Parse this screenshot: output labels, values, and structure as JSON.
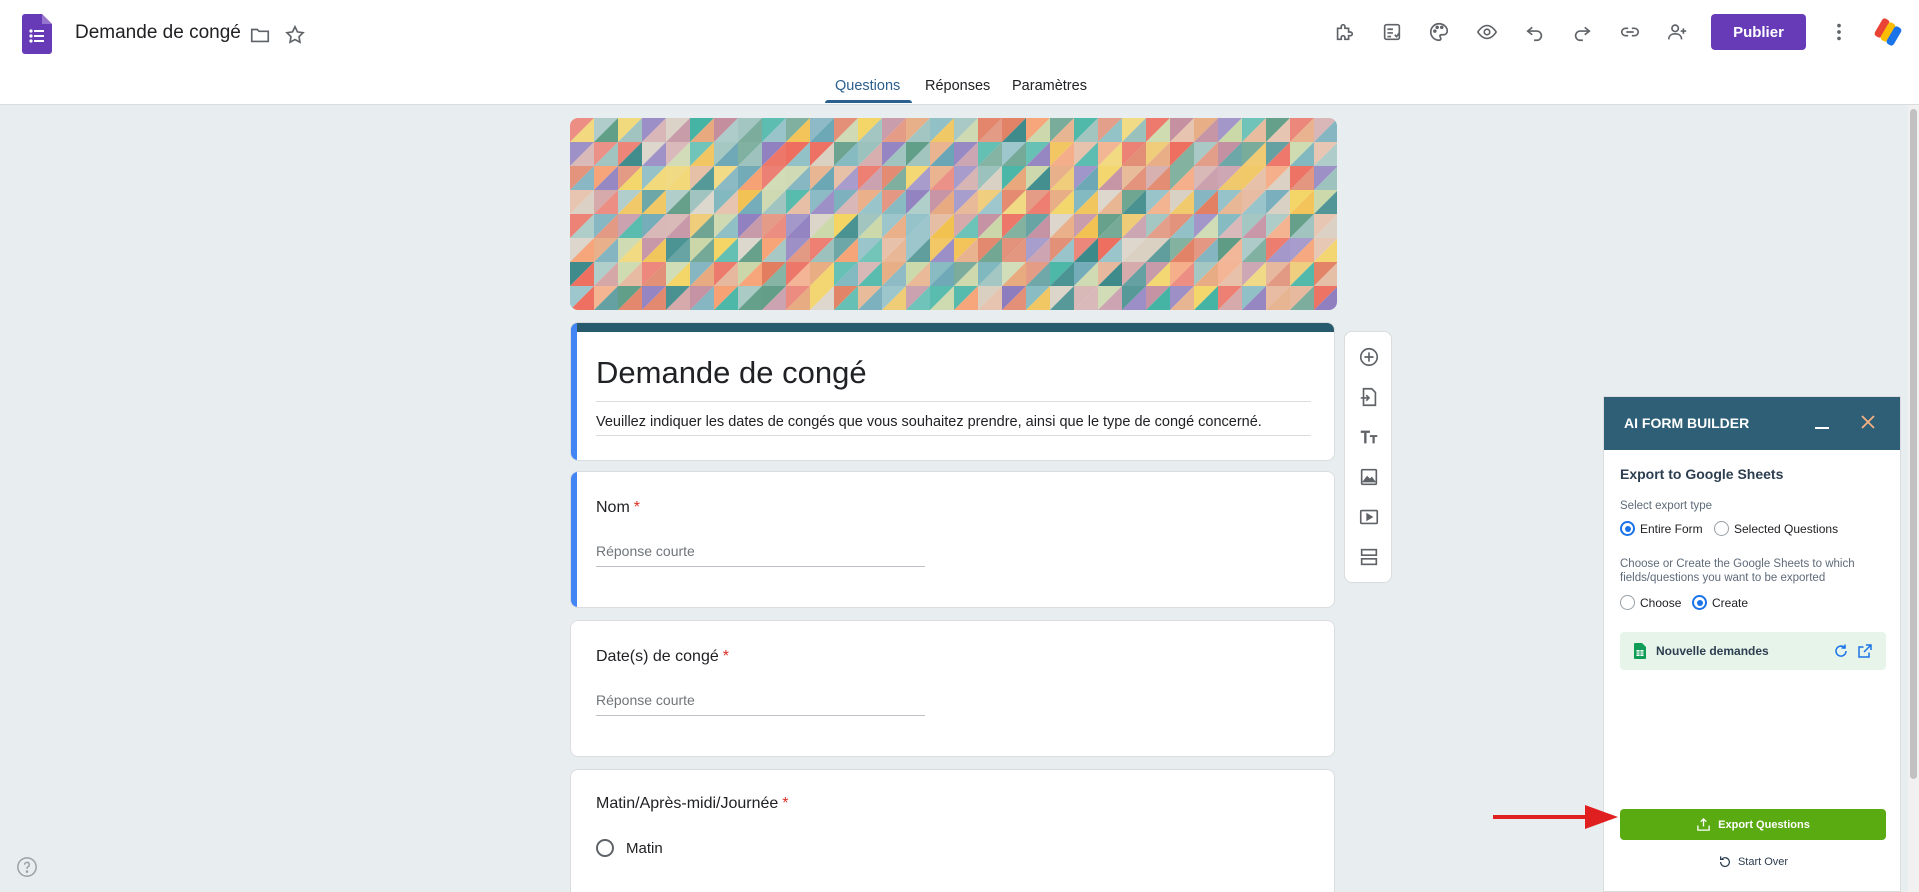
{
  "header": {
    "doc_title": "Demande de congé",
    "publish_label": "Publier"
  },
  "tabs": [
    {
      "label": "Questions",
      "active": true
    },
    {
      "label": "Réponses",
      "active": false
    },
    {
      "label": "Paramètres",
      "active": false
    }
  ],
  "form": {
    "title": "Demande de congé",
    "description": "Veuillez indiquer les dates de congés que vous souhaitez prendre, ainsi que le type de congé concerné.",
    "questions": [
      {
        "label": "Nom",
        "required_mark": "*",
        "placeholder": "Réponse courte"
      },
      {
        "label": "Date(s) de congé",
        "required_mark": "*",
        "placeholder": "Réponse courte"
      },
      {
        "label": "Matin/Après-midi/Journée",
        "required_mark": "*",
        "options": [
          "Matin"
        ]
      }
    ]
  },
  "panel": {
    "title": "AI FORM BUILDER",
    "heading": "Export to Google Sheets",
    "export_type_label": "Select export type",
    "export_type_options": [
      {
        "label": "Entire Form",
        "checked": true
      },
      {
        "label": "Selected Questions",
        "checked": false
      }
    ],
    "sheet_instruction": "Choose or Create the Google Sheets to which fields/questions you want to be exported",
    "sheet_mode_options": [
      {
        "label": "Choose",
        "checked": false
      },
      {
        "label": "Create",
        "checked": true
      }
    ],
    "sheet_name": "Nouvelle demandes",
    "export_button_label": "Export Questions",
    "start_over_label": "Start Over"
  },
  "colors": {
    "brand_purple": "#673ab7",
    "header_teal": "#2e5f76",
    "export_green": "#5aaa12",
    "active_tab": "#2b5f8e",
    "annotation_arrow": "#e02020"
  }
}
